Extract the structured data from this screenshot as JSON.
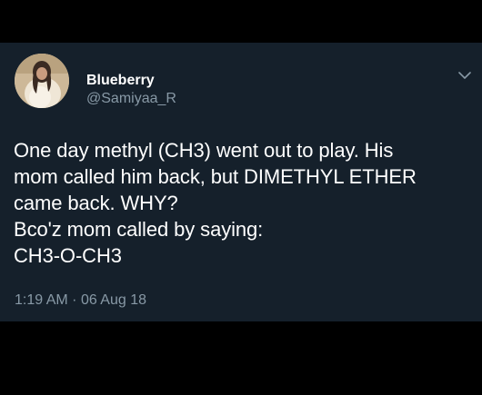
{
  "tweet": {
    "display_name": "Blueberry",
    "handle": "@Samiyaa_R",
    "text_lines": [
      "One day methyl (CH3) went out to play. His",
      "mom called him back, but DIMETHYL ETHER",
      "came back. WHY?",
      "Bco'z mom called by saying:",
      "CH3-O-CH3"
    ],
    "time": "1:19 AM",
    "separator": "·",
    "date": "06 Aug 18"
  },
  "icons": {
    "menu": "chevron-down-icon",
    "avatar": "profile-photo"
  },
  "colors": {
    "card_background": "#15202b",
    "outer_background": "#000000",
    "primary_text": "#ffffff",
    "secondary_text": "#8899a6"
  }
}
